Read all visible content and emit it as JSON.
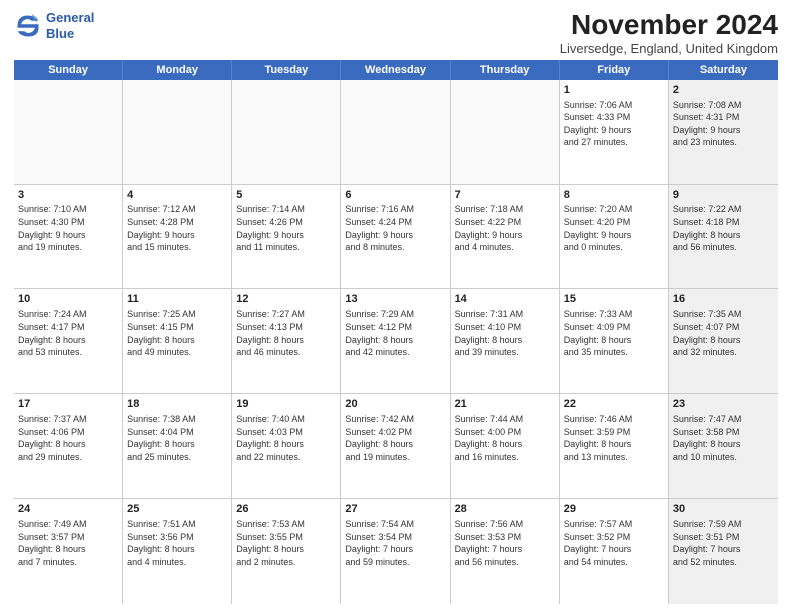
{
  "logo": {
    "line1": "General",
    "line2": "Blue"
  },
  "title": "November 2024",
  "location": "Liversedge, England, United Kingdom",
  "weekdays": [
    "Sunday",
    "Monday",
    "Tuesday",
    "Wednesday",
    "Thursday",
    "Friday",
    "Saturday"
  ],
  "weeks": [
    [
      {
        "day": "",
        "info": "",
        "shaded": false,
        "empty": true
      },
      {
        "day": "",
        "info": "",
        "shaded": false,
        "empty": true
      },
      {
        "day": "",
        "info": "",
        "shaded": false,
        "empty": true
      },
      {
        "day": "",
        "info": "",
        "shaded": false,
        "empty": true
      },
      {
        "day": "",
        "info": "",
        "shaded": false,
        "empty": true
      },
      {
        "day": "1",
        "info": "Sunrise: 7:06 AM\nSunset: 4:33 PM\nDaylight: 9 hours\nand 27 minutes.",
        "shaded": false,
        "empty": false
      },
      {
        "day": "2",
        "info": "Sunrise: 7:08 AM\nSunset: 4:31 PM\nDaylight: 9 hours\nand 23 minutes.",
        "shaded": true,
        "empty": false
      }
    ],
    [
      {
        "day": "3",
        "info": "Sunrise: 7:10 AM\nSunset: 4:30 PM\nDaylight: 9 hours\nand 19 minutes.",
        "shaded": false,
        "empty": false
      },
      {
        "day": "4",
        "info": "Sunrise: 7:12 AM\nSunset: 4:28 PM\nDaylight: 9 hours\nand 15 minutes.",
        "shaded": false,
        "empty": false
      },
      {
        "day": "5",
        "info": "Sunrise: 7:14 AM\nSunset: 4:26 PM\nDaylight: 9 hours\nand 11 minutes.",
        "shaded": false,
        "empty": false
      },
      {
        "day": "6",
        "info": "Sunrise: 7:16 AM\nSunset: 4:24 PM\nDaylight: 9 hours\nand 8 minutes.",
        "shaded": false,
        "empty": false
      },
      {
        "day": "7",
        "info": "Sunrise: 7:18 AM\nSunset: 4:22 PM\nDaylight: 9 hours\nand 4 minutes.",
        "shaded": false,
        "empty": false
      },
      {
        "day": "8",
        "info": "Sunrise: 7:20 AM\nSunset: 4:20 PM\nDaylight: 9 hours\nand 0 minutes.",
        "shaded": false,
        "empty": false
      },
      {
        "day": "9",
        "info": "Sunrise: 7:22 AM\nSunset: 4:18 PM\nDaylight: 8 hours\nand 56 minutes.",
        "shaded": true,
        "empty": false
      }
    ],
    [
      {
        "day": "10",
        "info": "Sunrise: 7:24 AM\nSunset: 4:17 PM\nDaylight: 8 hours\nand 53 minutes.",
        "shaded": false,
        "empty": false
      },
      {
        "day": "11",
        "info": "Sunrise: 7:25 AM\nSunset: 4:15 PM\nDaylight: 8 hours\nand 49 minutes.",
        "shaded": false,
        "empty": false
      },
      {
        "day": "12",
        "info": "Sunrise: 7:27 AM\nSunset: 4:13 PM\nDaylight: 8 hours\nand 46 minutes.",
        "shaded": false,
        "empty": false
      },
      {
        "day": "13",
        "info": "Sunrise: 7:29 AM\nSunset: 4:12 PM\nDaylight: 8 hours\nand 42 minutes.",
        "shaded": false,
        "empty": false
      },
      {
        "day": "14",
        "info": "Sunrise: 7:31 AM\nSunset: 4:10 PM\nDaylight: 8 hours\nand 39 minutes.",
        "shaded": false,
        "empty": false
      },
      {
        "day": "15",
        "info": "Sunrise: 7:33 AM\nSunset: 4:09 PM\nDaylight: 8 hours\nand 35 minutes.",
        "shaded": false,
        "empty": false
      },
      {
        "day": "16",
        "info": "Sunrise: 7:35 AM\nSunset: 4:07 PM\nDaylight: 8 hours\nand 32 minutes.",
        "shaded": true,
        "empty": false
      }
    ],
    [
      {
        "day": "17",
        "info": "Sunrise: 7:37 AM\nSunset: 4:06 PM\nDaylight: 8 hours\nand 29 minutes.",
        "shaded": false,
        "empty": false
      },
      {
        "day": "18",
        "info": "Sunrise: 7:38 AM\nSunset: 4:04 PM\nDaylight: 8 hours\nand 25 minutes.",
        "shaded": false,
        "empty": false
      },
      {
        "day": "19",
        "info": "Sunrise: 7:40 AM\nSunset: 4:03 PM\nDaylight: 8 hours\nand 22 minutes.",
        "shaded": false,
        "empty": false
      },
      {
        "day": "20",
        "info": "Sunrise: 7:42 AM\nSunset: 4:02 PM\nDaylight: 8 hours\nand 19 minutes.",
        "shaded": false,
        "empty": false
      },
      {
        "day": "21",
        "info": "Sunrise: 7:44 AM\nSunset: 4:00 PM\nDaylight: 8 hours\nand 16 minutes.",
        "shaded": false,
        "empty": false
      },
      {
        "day": "22",
        "info": "Sunrise: 7:46 AM\nSunset: 3:59 PM\nDaylight: 8 hours\nand 13 minutes.",
        "shaded": false,
        "empty": false
      },
      {
        "day": "23",
        "info": "Sunrise: 7:47 AM\nSunset: 3:58 PM\nDaylight: 8 hours\nand 10 minutes.",
        "shaded": true,
        "empty": false
      }
    ],
    [
      {
        "day": "24",
        "info": "Sunrise: 7:49 AM\nSunset: 3:57 PM\nDaylight: 8 hours\nand 7 minutes.",
        "shaded": false,
        "empty": false
      },
      {
        "day": "25",
        "info": "Sunrise: 7:51 AM\nSunset: 3:56 PM\nDaylight: 8 hours\nand 4 minutes.",
        "shaded": false,
        "empty": false
      },
      {
        "day": "26",
        "info": "Sunrise: 7:53 AM\nSunset: 3:55 PM\nDaylight: 8 hours\nand 2 minutes.",
        "shaded": false,
        "empty": false
      },
      {
        "day": "27",
        "info": "Sunrise: 7:54 AM\nSunset: 3:54 PM\nDaylight: 7 hours\nand 59 minutes.",
        "shaded": false,
        "empty": false
      },
      {
        "day": "28",
        "info": "Sunrise: 7:56 AM\nSunset: 3:53 PM\nDaylight: 7 hours\nand 56 minutes.",
        "shaded": false,
        "empty": false
      },
      {
        "day": "29",
        "info": "Sunrise: 7:57 AM\nSunset: 3:52 PM\nDaylight: 7 hours\nand 54 minutes.",
        "shaded": false,
        "empty": false
      },
      {
        "day": "30",
        "info": "Sunrise: 7:59 AM\nSunset: 3:51 PM\nDaylight: 7 hours\nand 52 minutes.",
        "shaded": true,
        "empty": false
      }
    ]
  ]
}
